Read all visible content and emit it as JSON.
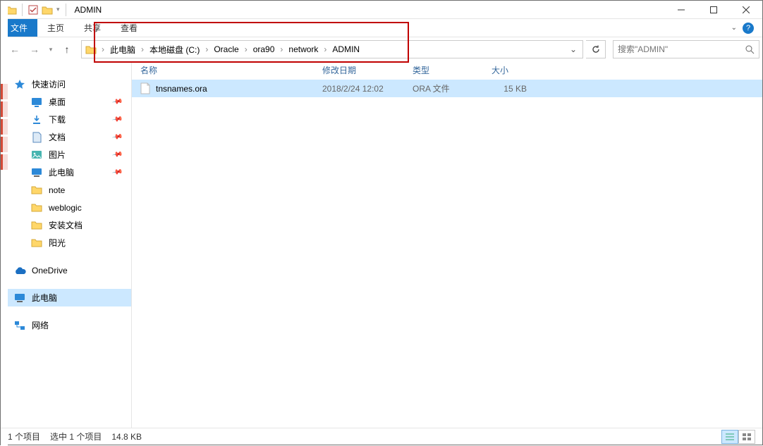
{
  "window": {
    "title": "ADMIN"
  },
  "ribbon": {
    "file": "文件",
    "tabs": [
      "主页",
      "共享",
      "查看"
    ]
  },
  "breadcrumb": {
    "items": [
      "此电脑",
      "本地磁盘 (C:)",
      "Oracle",
      "ora90",
      "network",
      "ADMIN"
    ]
  },
  "search": {
    "placeholder": "搜索\"ADMIN\""
  },
  "sidebar": {
    "quick_access": "快速访问",
    "items": [
      {
        "label": "桌面",
        "icon": "desktop",
        "pinned": true
      },
      {
        "label": "下载",
        "icon": "download",
        "pinned": true
      },
      {
        "label": "文档",
        "icon": "document",
        "pinned": true
      },
      {
        "label": "图片",
        "icon": "pictures",
        "pinned": true
      },
      {
        "label": "此电脑",
        "icon": "pc",
        "pinned": true
      },
      {
        "label": "note",
        "icon": "folder",
        "pinned": false
      },
      {
        "label": "weblogic",
        "icon": "folder",
        "pinned": false
      },
      {
        "label": "安装文档",
        "icon": "folder",
        "pinned": false
      },
      {
        "label": "阳光",
        "icon": "folder",
        "pinned": false
      }
    ],
    "onedrive": "OneDrive",
    "this_pc": "此电脑",
    "network": "网络"
  },
  "columns": {
    "name": "名称",
    "date": "修改日期",
    "type": "类型",
    "size": "大小"
  },
  "files": [
    {
      "name": "tnsnames.ora",
      "date": "2018/2/24 12:02",
      "type": "ORA 文件",
      "size": "15 KB",
      "selected": true
    }
  ],
  "status": {
    "count": "1 个项目",
    "selection": "选中 1 个项目",
    "sel_size": "14.8 KB"
  }
}
